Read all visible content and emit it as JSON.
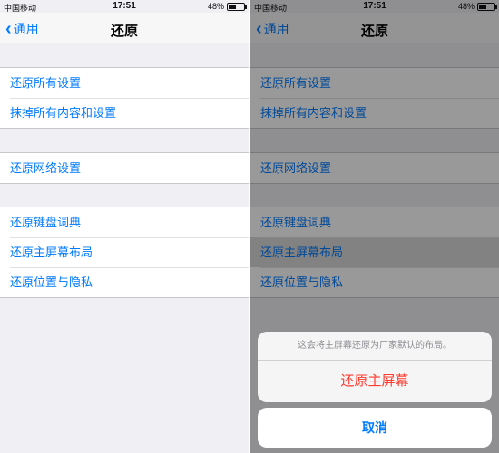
{
  "status": {
    "carrier": "中国移动",
    "time": "17:51",
    "battery": "48%",
    "battery_level": 0.48
  },
  "nav": {
    "back": "通用",
    "title": "还原"
  },
  "groups": [
    [
      "还原所有设置",
      "抹掉所有内容和设置"
    ],
    [
      "还原网络设置"
    ],
    [
      "还原键盘词典",
      "还原主屏幕布局",
      "还原位置与隐私"
    ]
  ],
  "sheet": {
    "message": "这会将主屏幕还原为厂家默认的布局。",
    "destructive": "还原主屏幕",
    "cancel": "取消"
  },
  "colors": {
    "accent": "#007aff",
    "destructive": "#ff3b30"
  }
}
